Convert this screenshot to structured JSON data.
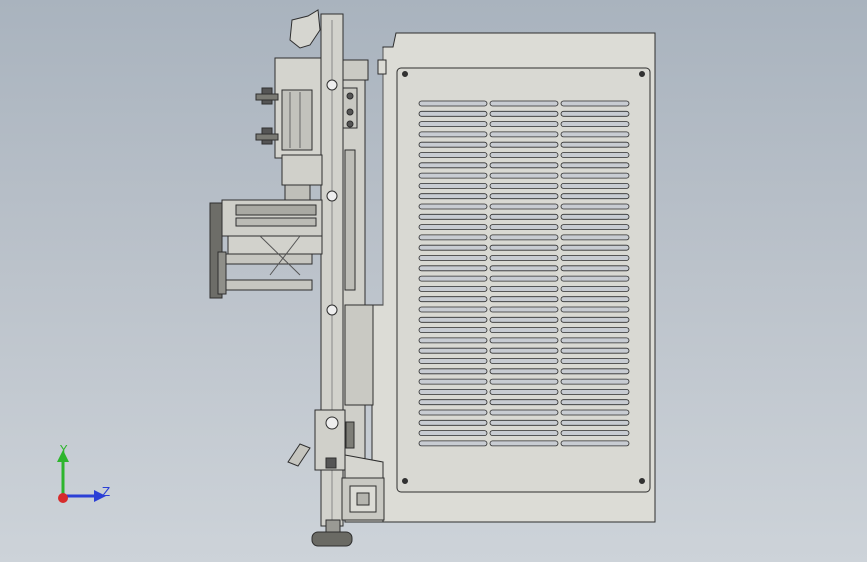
{
  "viewport": {
    "background_top": "#a9b3be",
    "background_bottom": "#cdd3d9"
  },
  "triad": {
    "y_label": "Y",
    "z_label": "Z",
    "y_color": "#2db52d",
    "z_color": "#2b3fd6",
    "x_color": "#d62b2b"
  },
  "model": {
    "cabinet_color": "#dcdcd6",
    "frame_color": "#d2d2cc",
    "outline_color": "#2e2e2e",
    "vent_columns": 3,
    "vent_rows": 34
  }
}
